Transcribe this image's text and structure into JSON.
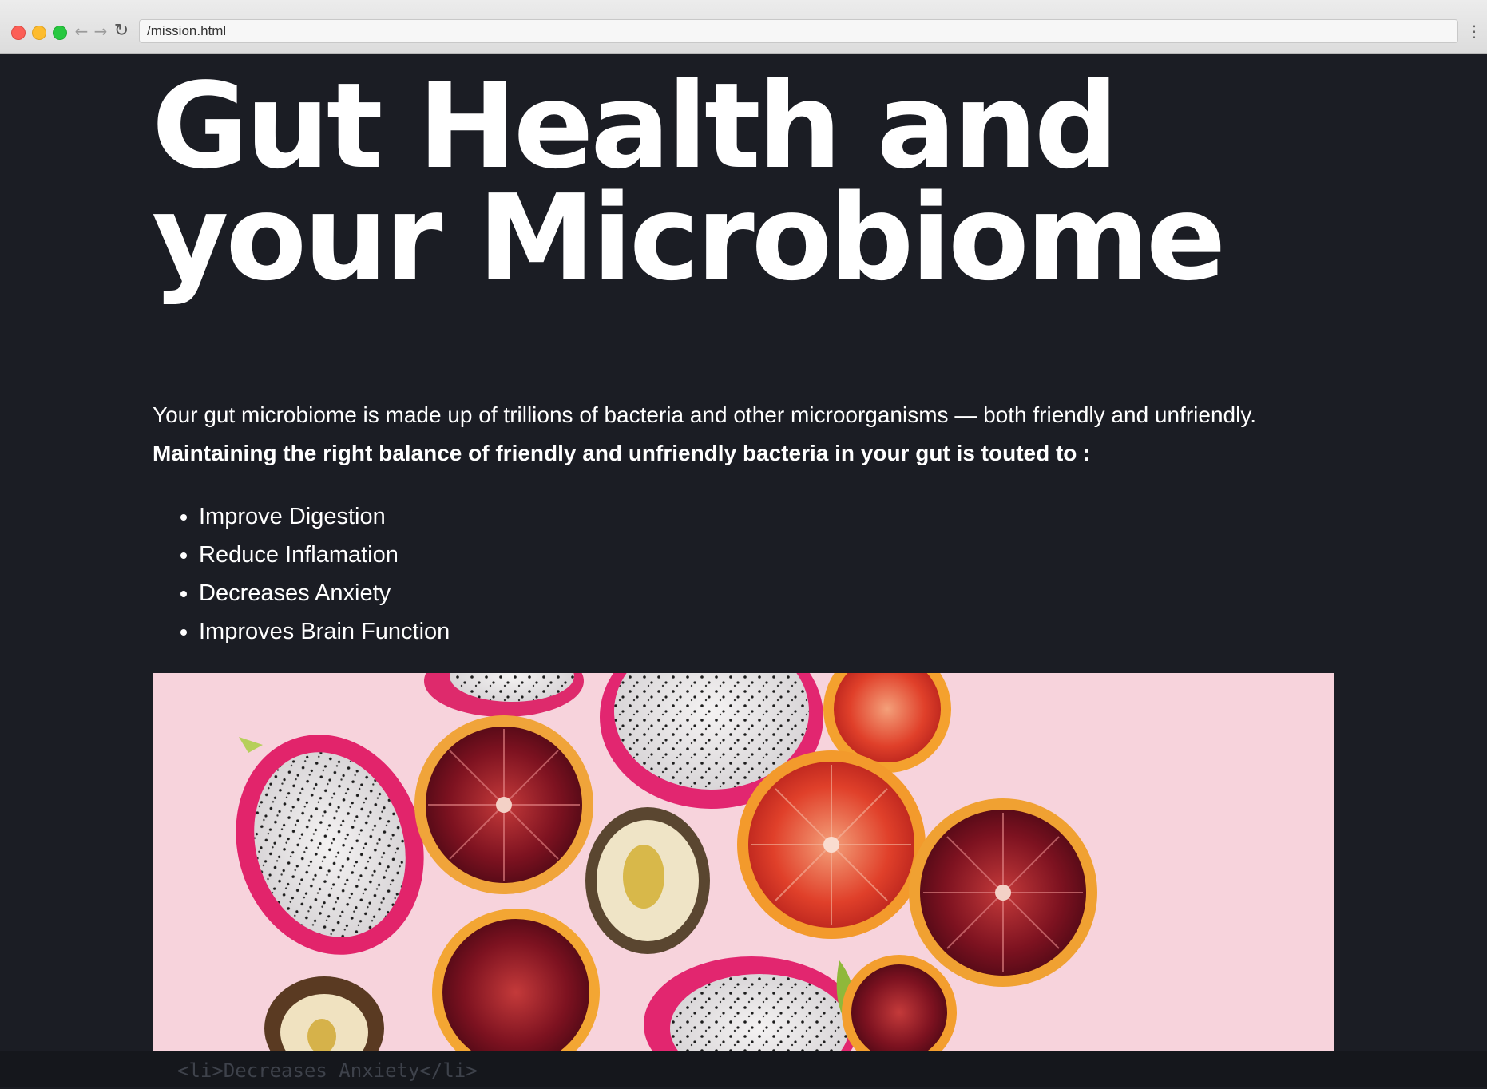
{
  "browser": {
    "url": "/mission.html",
    "back_icon": "arrow-left-icon",
    "forward_icon": "arrow-right-icon",
    "reload_icon": "reload-icon",
    "menu_icon": "kebab-menu-icon"
  },
  "page": {
    "heading_line1": "Gut Health and",
    "heading_line2": "your Microbiome",
    "intro_text": "Your gut microbiome is made up of trillions of bacteria and other microorganisms — both friendly and unfriendly.",
    "intro_bold": "Maintaining the right balance of friendly and unfriendly bacteria in your gut is touted to :",
    "benefits": [
      "Improve Digestion",
      "Reduce Inflamation",
      "Decreases Anxiety",
      "Improves Brain Function"
    ],
    "hero_image": "fruit-photo"
  },
  "devbar": {
    "code_line": "<li>Decreases Anxiety</li>"
  },
  "colors": {
    "page_bg": "#1b1d24",
    "text": "#ffffff",
    "image_bg": "#f7d3dc"
  }
}
